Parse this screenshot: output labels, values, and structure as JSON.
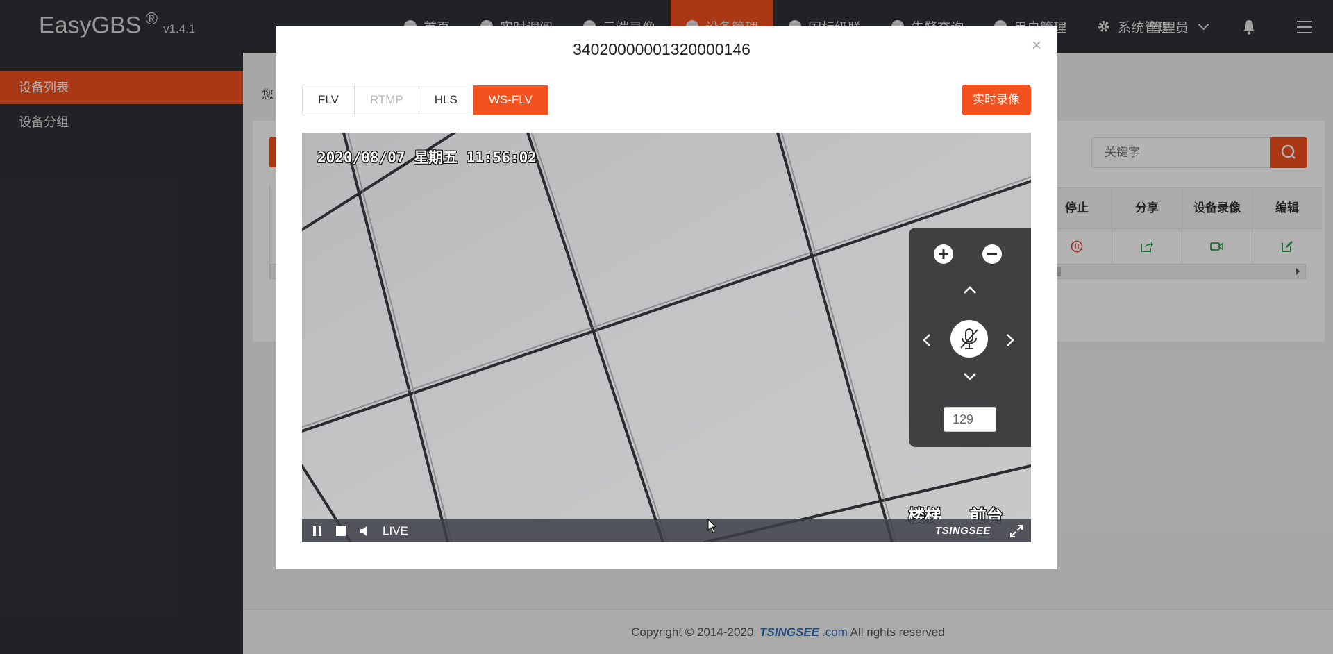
{
  "app": {
    "name": "EasyGBS",
    "reg": "®",
    "version": "v1.4.1"
  },
  "nav": [
    {
      "label": "首页",
      "active": false
    },
    {
      "label": "实时调阅",
      "active": false
    },
    {
      "label": "云端录像",
      "active": false
    },
    {
      "label": "设备管理",
      "active": true
    },
    {
      "label": "国标级联",
      "active": false
    },
    {
      "label": "告警查询",
      "active": false
    },
    {
      "label": "用户管理",
      "active": false
    },
    {
      "label": "系统管理",
      "active": false
    }
  ],
  "user": {
    "name": "管理员"
  },
  "sidebar": {
    "items": [
      {
        "label": "设备列表",
        "active": true
      },
      {
        "label": "设备分组",
        "active": false
      }
    ]
  },
  "main": {
    "hint": "您",
    "search": {
      "placeholder": "关键字"
    },
    "table": {
      "headers": [
        "停止",
        "分享",
        "设备录像",
        "编辑"
      ]
    }
  },
  "footer": {
    "prefix": "Copyright © 2014-2020",
    "brand": "TSINGSEE",
    "dotcom": ".com",
    "suffix": "All rights reserved"
  },
  "modal": {
    "title": "34020000001320000146",
    "close": "×",
    "tabs": [
      {
        "label": "FLV",
        "state": "normal"
      },
      {
        "label": "RTMP",
        "state": "disabled"
      },
      {
        "label": "HLS",
        "state": "normal"
      },
      {
        "label": "WS-FLV",
        "state": "active"
      }
    ],
    "record_button": "实时录像",
    "video": {
      "osd_time": "2020/08/07 星期五 11:56:02",
      "osd_label": "楼梯 前台",
      "live": "LIVE",
      "player_logo": "TSINGSEE",
      "ptz_speed": "129"
    }
  },
  "colors": {
    "accent": "#f4511e",
    "topbar": "#2f3236",
    "action_green": "#2e9e4f",
    "stop_red": "#e53935"
  },
  "icons": [
    "zoom-in-icon",
    "zoom-out-icon",
    "chevron-up-icon",
    "chevron-down-icon",
    "chevron-left-icon",
    "chevron-right-icon",
    "mic-off-icon",
    "pause-icon",
    "stop-icon",
    "volume-icon",
    "fullscreen-icon",
    "bell-icon",
    "menu-icon",
    "search-icon",
    "share-icon",
    "video-record-icon",
    "edit-icon"
  ]
}
